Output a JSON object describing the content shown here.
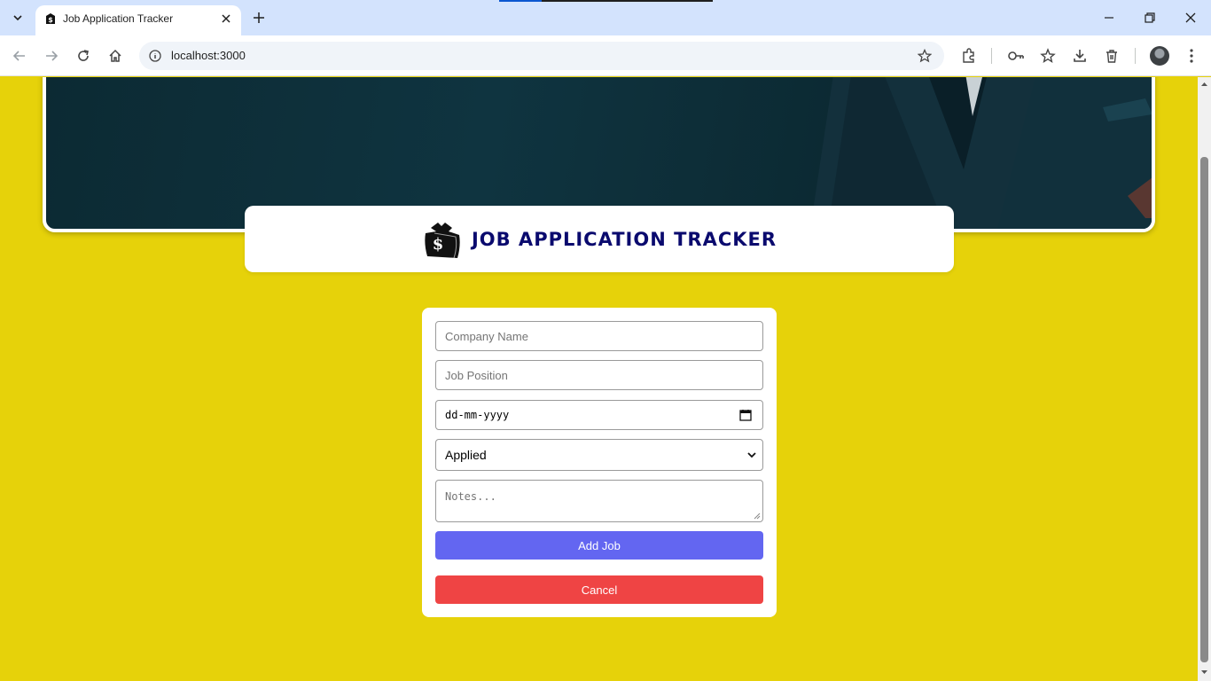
{
  "browser": {
    "tab_title": "Job Application Tracker",
    "url": "localhost:3000"
  },
  "app": {
    "title": "JOB APPLICATION TRACKER"
  },
  "form": {
    "company_placeholder": "Company Name",
    "position_placeholder": "Job Position",
    "date_placeholder": "dd-mm-yyyy",
    "status_selected": "Applied",
    "notes_placeholder": "Notes...",
    "add_label": "Add Job",
    "cancel_label": "Cancel"
  },
  "colors": {
    "page_background": "#e6d20a",
    "add_button": "#6366f1",
    "cancel_button": "#ef4444",
    "title_text": "#0a0a6e"
  }
}
